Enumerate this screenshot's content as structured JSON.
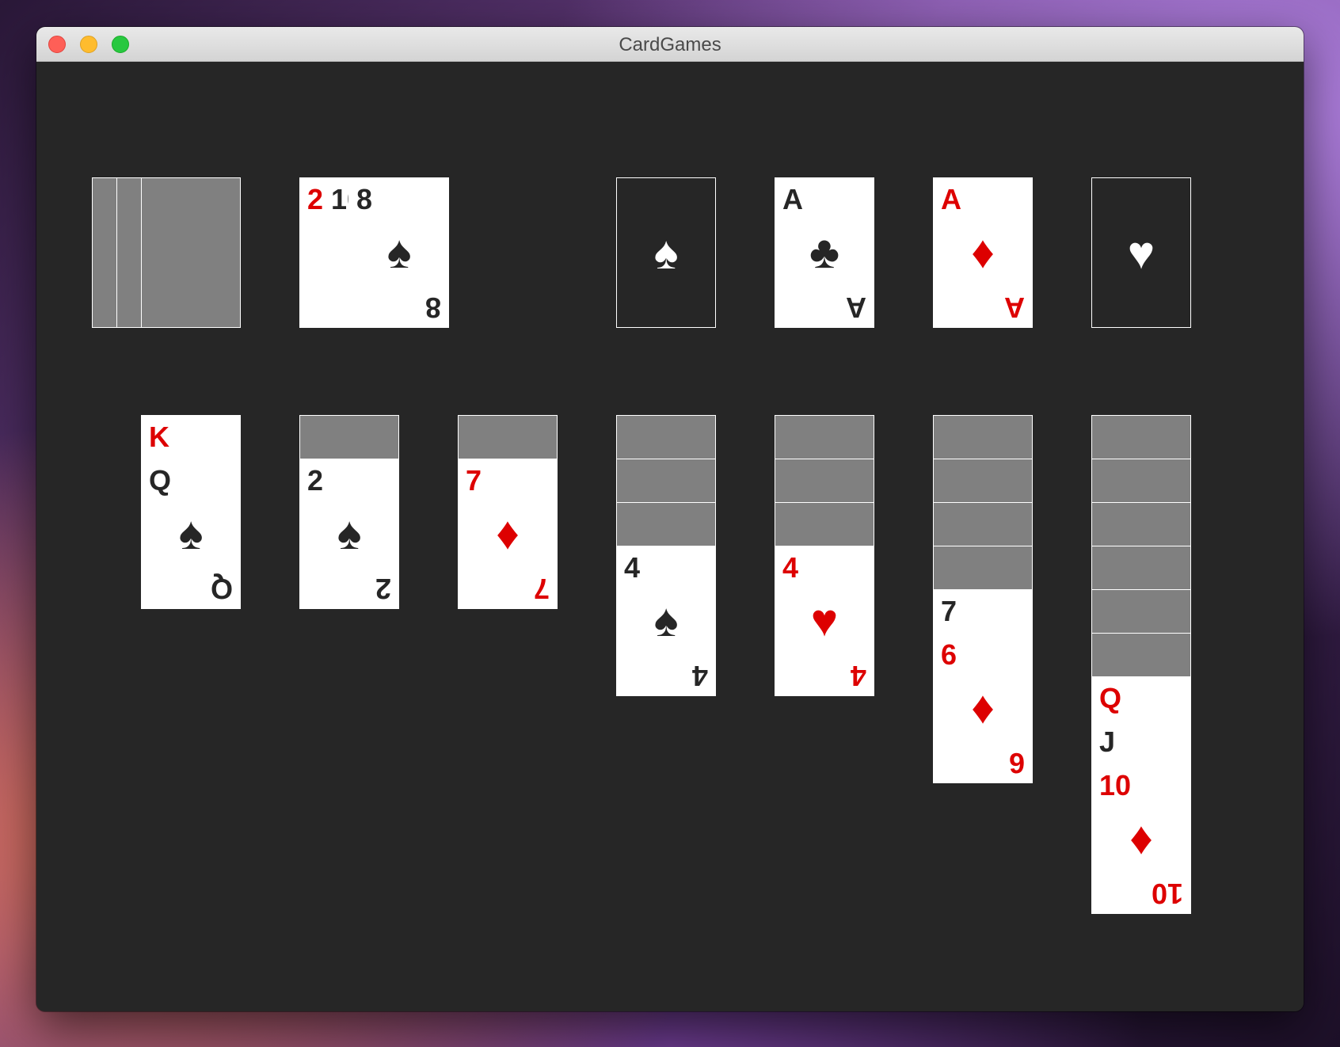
{
  "window": {
    "title": "CardGames"
  },
  "stock": {
    "state": "face-down"
  },
  "waste": {
    "back_ranks": [
      {
        "rank": "2",
        "color": "red"
      },
      {
        "rank": "10",
        "color": "black"
      }
    ],
    "top": {
      "rank": "8",
      "suit_icon": "spade-icon",
      "symbol": "♠",
      "color": "black"
    }
  },
  "foundations": [
    {
      "state": "empty",
      "suit_icon": "spade-icon",
      "symbol": "♠"
    },
    {
      "rank": "A",
      "suit_icon": "club-icon",
      "symbol": "♣",
      "color": "black"
    },
    {
      "rank": "A",
      "suit_icon": "diamond-icon",
      "symbol": "♦",
      "color": "red"
    },
    {
      "state": "empty",
      "suit_icon": "heart-icon",
      "symbol": "♥"
    }
  ],
  "tableau": [
    {
      "facedown": 0,
      "faceup": [
        {
          "rank": "K",
          "color": "red"
        },
        {
          "rank": "Q",
          "symbol": "♠",
          "suit_icon": "spade-icon",
          "color": "black"
        }
      ]
    },
    {
      "facedown": 1,
      "faceup": [
        {
          "rank": "2",
          "symbol": "♠",
          "suit_icon": "spade-icon",
          "color": "black"
        }
      ]
    },
    {
      "facedown": 1,
      "faceup": [
        {
          "rank": "7",
          "symbol": "♦",
          "suit_icon": "diamond-icon",
          "color": "red"
        }
      ]
    },
    {
      "facedown": 3,
      "faceup": [
        {
          "rank": "4",
          "symbol": "♠",
          "suit_icon": "spade-icon",
          "color": "black"
        }
      ]
    },
    {
      "facedown": 3,
      "faceup": [
        {
          "rank": "4",
          "symbol": "♥",
          "suit_icon": "heart-icon",
          "color": "red"
        }
      ]
    },
    {
      "facedown": 4,
      "faceup": [
        {
          "rank": "7",
          "color": "black"
        },
        {
          "rank": "6",
          "symbol": "♦",
          "suit_icon": "diamond-icon",
          "color": "red"
        }
      ]
    },
    {
      "facedown": 6,
      "faceup": [
        {
          "rank": "Q",
          "color": "red"
        },
        {
          "rank": "J",
          "color": "black"
        },
        {
          "rank": "10",
          "symbol": "♦",
          "suit_icon": "diamond-icon",
          "color": "red"
        }
      ]
    }
  ],
  "colors": {
    "table": "#262626",
    "card_back": "#808080",
    "red_suit": "#dd0000",
    "black_suit": "#262626"
  }
}
